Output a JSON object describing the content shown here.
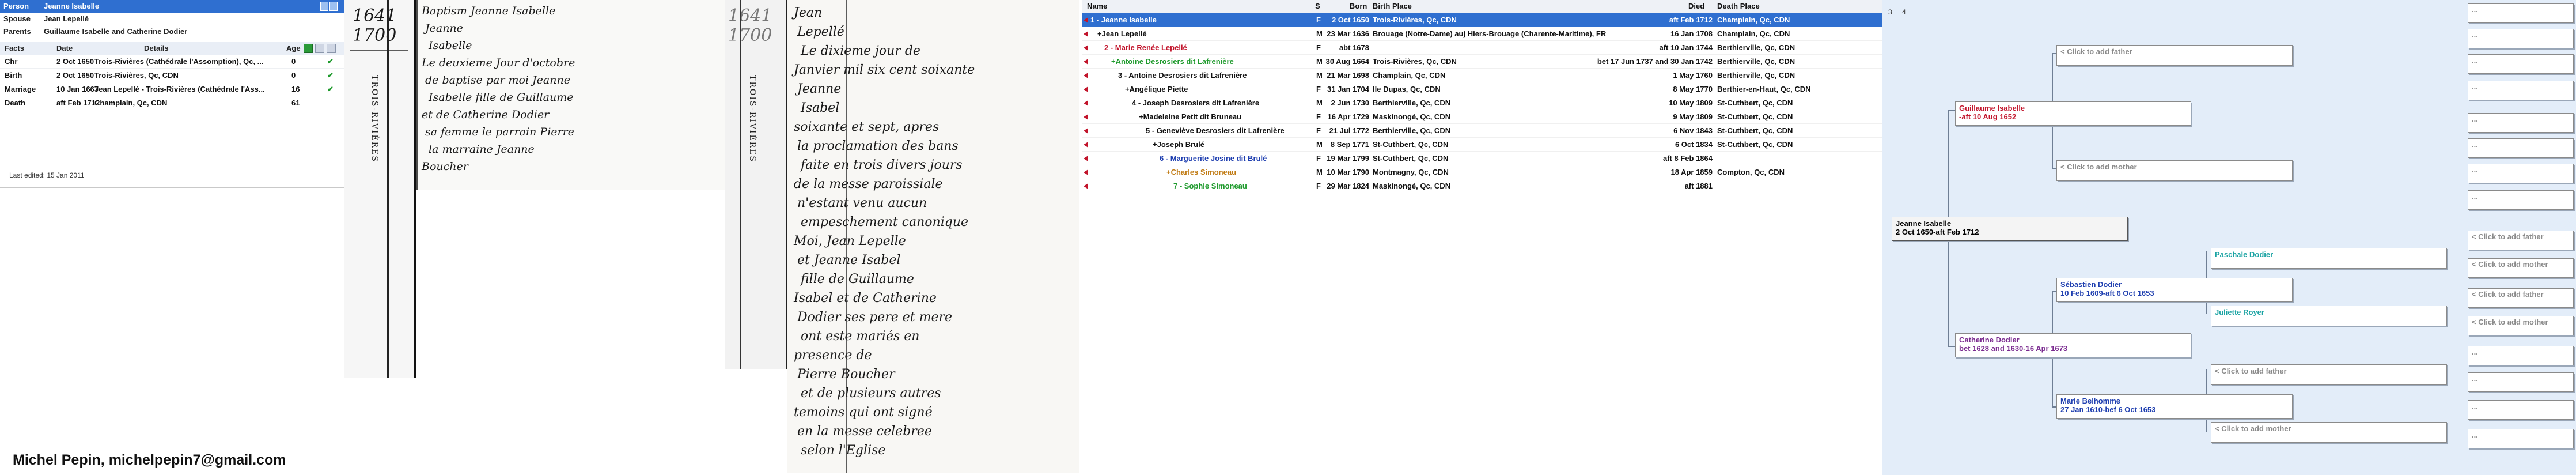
{
  "person_panel": {
    "person_label": "Person",
    "person_name": "Jeanne Isabelle",
    "spouse_label": "Spouse",
    "spouse_name": "Jean Lepellé",
    "parents_label": "Parents",
    "parents_names": "Guillaume Isabelle and Catherine Dodier",
    "columns": [
      "Facts",
      "Date",
      "Details",
      "Age"
    ],
    "facts": [
      {
        "fact": "Chr",
        "date": "2 Oct 1650",
        "details": "Trois-Rivières (Cathédrale l'Assomption), Qc, ...",
        "age": "0"
      },
      {
        "fact": "Birth",
        "date": "2 Oct 1650",
        "details": "Trois-Rivières, Qc, CDN",
        "age": "0"
      },
      {
        "fact": "Marriage",
        "date": "10 Jan 1667",
        "details": "Jean Lepellé - Trois-Rivières (Cathédrale l'Ass...",
        "age": "16"
      },
      {
        "fact": "Death",
        "date": "aft Feb 1712",
        "details": "Champlain, Qc, CDN",
        "age": "61"
      }
    ],
    "last_edited": "Last edited: 15 Jan 2011"
  },
  "scans": {
    "a": {
      "year_top": "1641",
      "year_bottom": "1700",
      "vertical": "TROIS-RIVIÈRES"
    },
    "b": {
      "lines": [
        "Baptism Jeanne Isabelle",
        "Jeanne",
        "Isabelle",
        "Le deuxieme Jour d'octobre",
        "de baptise par moi Jeanne",
        "Isabelle fille de Guillaume",
        "et de Catherine Dodier",
        "sa femme le parrain Pierre",
        "la marraine Jeanne",
        "Boucher"
      ]
    },
    "c": {
      "year_top": "1641",
      "year_bottom": "1700",
      "vertical": "TROIS-RIVIÈRES"
    },
    "d": {
      "lines": [
        "Jean",
        "Lepellé",
        "Le dixieme jour de",
        "Janvier mil six cent soixante",
        "Jeanne",
        "Isabel",
        "soixante et sept, apres",
        "la proclamation des bans",
        "faite en trois divers jours",
        "de la messe paroissiale",
        "n'estant venu aucun",
        "empeschement canonique",
        "Moi, Jean Lepelle",
        "et Jeanne Isabel",
        "fille de Guillaume",
        "Isabel et de Catherine",
        "Dodier ses pere et mere",
        "ont este mariés en",
        "presence de",
        "Pierre Boucher",
        "et de plusieurs autres",
        "temoins qui ont signé",
        "en la messe celebree",
        "selon l'Eglise"
      ]
    }
  },
  "descendants": {
    "columns": [
      "Name",
      "S",
      "Born",
      "Birth Place",
      "Died",
      "Death Place"
    ],
    "rows": [
      {
        "name": "1 - Jeanne Isabelle",
        "sex": "F",
        "born": "2 Oct 1650",
        "birth_place": "Trois-Rivières, Qc, CDN",
        "died": "aft Feb 1712",
        "death_place": "Champlain, Qc, CDN",
        "color": "#ffffff",
        "indent": 0
      },
      {
        "name": "+Jean Lepellé",
        "sex": "M",
        "born": "23 Mar 1636",
        "birth_place": "Brouage (Notre-Dame) auj Hiers-Brouage (Charente-Maritime), FR",
        "died": "16 Jan 1708",
        "death_place": "Champlain, Qc, CDN",
        "color": "#111111",
        "indent": 1
      },
      {
        "name": "2 - Marie Renée Lepellé",
        "sex": "F",
        "born": "abt 1678",
        "birth_place": "",
        "died": "aft 10 Jan 1744",
        "death_place": "Berthierville, Qc, CDN",
        "color": "#c2152c",
        "indent": 2
      },
      {
        "name": "+Antoine Desrosiers dit Lafrenière",
        "sex": "M",
        "born": "30 Aug 1664",
        "birth_place": "Trois-Rivières, Qc, CDN",
        "died": "bet 17 Jun 1737 and 30 Jan 1742",
        "death_place": "Berthierville, Qc, CDN",
        "color": "#1e9a2c",
        "indent": 3
      },
      {
        "name": "3 - Antoine Desrosiers dit Lafrenière",
        "sex": "M",
        "born": "21 Mar 1698",
        "birth_place": "Champlain, Qc, CDN",
        "died": "1 May 1760",
        "death_place": "Berthierville, Qc, CDN",
        "color": "#111111",
        "indent": 4
      },
      {
        "name": "+Angélique Piette",
        "sex": "F",
        "born": "31 Jan 1704",
        "birth_place": "Ile Dupas, Qc, CDN",
        "died": "8 May 1770",
        "death_place": "Berthier-en-Haut, Qc, CDN",
        "color": "#111111",
        "indent": 5
      },
      {
        "name": "4 - Joseph Desrosiers dit Lafrenière",
        "sex": "M",
        "born": "2 Jun 1730",
        "birth_place": "Berthierville, Qc, CDN",
        "died": "10 May 1809",
        "death_place": "St-Cuthbert, Qc, CDN",
        "color": "#111111",
        "indent": 6
      },
      {
        "name": "+Madeleine Petit dit Bruneau",
        "sex": "F",
        "born": "16 Apr 1729",
        "birth_place": "Maskinongé, Qc, CDN",
        "died": "9 May 1809",
        "death_place": "St-Cuthbert, Qc, CDN",
        "color": "#111111",
        "indent": 7
      },
      {
        "name": "5 - Geneviève Desrosiers dit Lafrenière",
        "sex": "F",
        "born": "21 Jul 1772",
        "birth_place": "Berthierville, Qc, CDN",
        "died": "6 Nov 1843",
        "death_place": "St-Cuthbert, Qc, CDN",
        "color": "#111111",
        "indent": 8
      },
      {
        "name": "+Joseph Brulé",
        "sex": "M",
        "born": "8 Sep 1771",
        "birth_place": "St-Cuthbert, Qc, CDN",
        "died": "6 Oct 1834",
        "death_place": "St-Cuthbert, Qc, CDN",
        "color": "#111111",
        "indent": 9
      },
      {
        "name": "6 - Marguerite Josine dit Brulé",
        "sex": "F",
        "born": "19 Mar 1799",
        "birth_place": "St-Cuthbert, Qc, CDN",
        "died": "aft 8 Feb 1864",
        "death_place": "",
        "color": "#1f3fb0",
        "indent": 10
      },
      {
        "name": "+Charles Simoneau",
        "sex": "M",
        "born": "10 Mar 1790",
        "birth_place": "Montmagny, Qc, CDN",
        "died": "18 Apr 1859",
        "death_place": "Compton, Qc, CDN",
        "color": "#c07a12",
        "indent": 11
      },
      {
        "name": "7 - Sophie Simoneau",
        "sex": "F",
        "born": "29 Mar 1824",
        "birth_place": "Maskinongé, Qc, CDN",
        "died": "aft 1881",
        "death_place": "",
        "color": "#1e9a2c",
        "indent": 12
      }
    ]
  },
  "pedigree": {
    "generation_numbers": [
      "3",
      "4"
    ],
    "focus": {
      "name": "Jeanne Isabelle",
      "dates": "2 Oct 1650-aft Feb 1712"
    },
    "father": {
      "name": "Guillaume Isabelle",
      "dates": "-aft 10 Aug 1652",
      "color": "#c2152c"
    },
    "mother": {
      "name": "Catherine Dodier",
      "dates": "bet 1628 and 1630-16 Apr 1673",
      "color": "#7a2a8f"
    },
    "ff": {
      "name": "< Click to add father"
    },
    "fm": {
      "name": "< Click to add mother"
    },
    "mf": {
      "name": "Sébastien Dodier",
      "dates": "10 Feb 1609-aft 6 Oct 1653",
      "color": "#1f3fb0"
    },
    "mm": {
      "name": "Marie Belhomme",
      "dates": "27 Jan 1610-bef 6 Oct 1653",
      "color": "#1f3fb0"
    },
    "mff": {
      "name": "Paschale Dodier",
      "color": "#1aa3a3"
    },
    "mfm": {
      "name": "Juliette Royer",
      "color": "#1aa3a3"
    },
    "click_father": "< Click to add father",
    "click_mother": "< Click to add mother",
    "ellipsis": "..."
  },
  "credit": "Michel Pepin, michelpepin7@gmail.com"
}
